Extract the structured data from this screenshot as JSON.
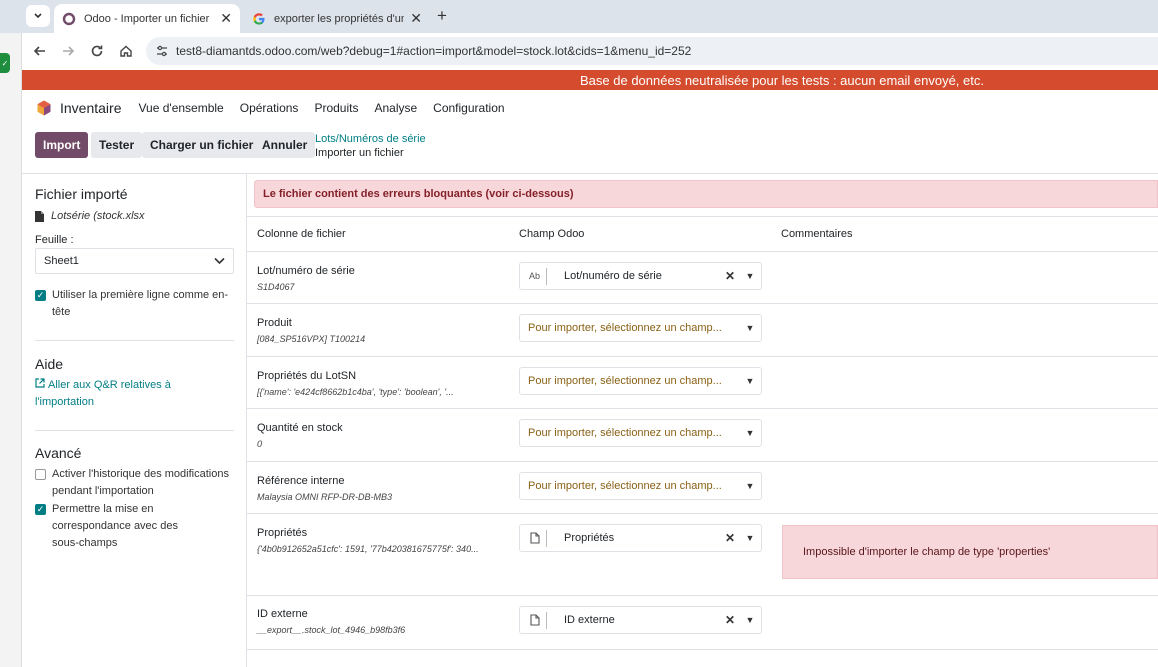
{
  "browser": {
    "tabs": [
      {
        "title": "Odoo - Importer un fichier",
        "active": true,
        "icon": "odoo-favicon"
      },
      {
        "title": "exporter les propriétés d'un lot",
        "active": false,
        "icon": "google-favicon"
      }
    ],
    "url": "test8-diamantds.odoo.com/web?debug=1#action=import&model=stock.lot&cids=1&menu_id=252"
  },
  "banner": {
    "text": "Base de données neutralisée pour les tests : aucun email envoyé, etc.",
    "color": "#d44c2d"
  },
  "navbar": {
    "app_name": "Inventaire",
    "menu": [
      "Vue d'ensemble",
      "Opérations",
      "Produits",
      "Analyse",
      "Configuration"
    ]
  },
  "control_panel": {
    "buttons": {
      "import": "Import",
      "test": "Tester",
      "load": "Charger un fichier",
      "cancel": "Annuler"
    },
    "breadcrumb": {
      "parent": "Lots/Numéros de série",
      "current": "Importer un fichier"
    }
  },
  "sidebar": {
    "file_title": "Fichier importé",
    "file_name": "Lotsérie (stock.xlsx",
    "sheet_label": "Feuille :",
    "sheet_value": "Sheet1",
    "first_line_header": {
      "label": "Utiliser la première ligne comme en-tête",
      "checked": true
    },
    "help_title": "Aide",
    "help_link": "Aller aux Q&R relatives à l'importation",
    "advanced_title": "Avancé",
    "tracking_option": {
      "label": "Activer l'historique des modifications pendant l'importation",
      "checked": false
    },
    "subfields_option": {
      "label": "Permettre la mise en correspondance avec des sous-champs",
      "checked": true
    }
  },
  "main": {
    "error_message": "Le fichier contient des erreurs bloquantes (voir ci-dessous)",
    "headers": {
      "file_column": "Colonne de fichier",
      "odoo_field": "Champ Odoo",
      "comments": "Commentaires"
    },
    "placeholder": "Pour importer, sélectionnez un champ...",
    "rows": [
      {
        "name": "Lot/numéro de série",
        "sample": "S1D4067",
        "field": "Lot/numéro de série",
        "type_icon": "Ab",
        "comment": ""
      },
      {
        "name": "Produit",
        "sample": "[084_SP516VPX] T100214",
        "field": "",
        "type_icon": "",
        "comment": ""
      },
      {
        "name": "Propriétés du LotSN",
        "sample": "[{'name': 'e424cf8662b1c4ba', 'type': 'boolean', '...",
        "field": "",
        "type_icon": "",
        "comment": ""
      },
      {
        "name": "Quantité en stock",
        "sample": "0",
        "field": "",
        "type_icon": "",
        "comment": ""
      },
      {
        "name": "Référence interne",
        "sample": "Malaysia OMNI RFP-DR-DB-MB3",
        "field": "",
        "type_icon": "",
        "comment": ""
      },
      {
        "name": "Propriétés",
        "sample": "{'4b0b912652a51cfc': 1591, '77b420381675775f': 340...",
        "field": "Propriétés",
        "type_icon": "file-icon",
        "comment": "Impossible d'importer le champ de type 'properties'"
      },
      {
        "name": "ID externe",
        "sample": "__export__.stock_lot_4946_b98fb3f6",
        "field": "ID externe",
        "type_icon": "file-icon",
        "comment": ""
      }
    ]
  }
}
